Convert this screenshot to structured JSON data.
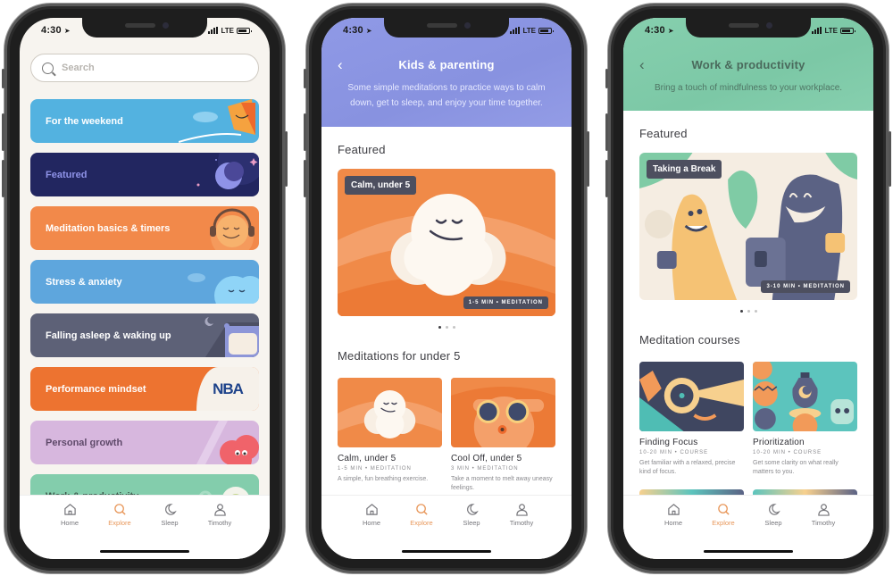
{
  "status_bar": {
    "time": "4:30",
    "network": "LTE"
  },
  "tabbar": {
    "items": [
      {
        "label": "Home",
        "icon": "home-icon"
      },
      {
        "label": "Explore",
        "icon": "search-icon",
        "active": true
      },
      {
        "label": "Sleep",
        "icon": "moon-icon"
      },
      {
        "label": "Timothy",
        "icon": "user-icon"
      }
    ],
    "active_color": "#e8975a"
  },
  "explore": {
    "search_placeholder": "Search",
    "categories": [
      {
        "label": "For the weekend",
        "color": "#53b2e0"
      },
      {
        "label": "Featured",
        "color": "#222660",
        "text_color": "#8f93e8"
      },
      {
        "label": "Meditation basics & timers",
        "color": "#f2894a"
      },
      {
        "label": "Stress & anxiety",
        "color": "#5ea6dd"
      },
      {
        "label": "Falling asleep & waking up",
        "color": "#5d6177"
      },
      {
        "label": "Performance mindset",
        "color": "#ed7330",
        "badge": "NBA"
      },
      {
        "label": "Personal growth",
        "color": "#d7b7de",
        "text_color": "#5f4a6a"
      },
      {
        "label": "Work & productivity",
        "color": "#83cdac",
        "text_color": "#3d5a4d"
      }
    ]
  },
  "kids": {
    "title": "Kids & parenting",
    "subtitle": "Some simple meditations to practice ways to calm down, get to sleep, and enjoy your time together.",
    "header_color": "#8d97e4",
    "featured_heading": "Featured",
    "featured": {
      "name": "Calm, under 5",
      "meta": "1-5 MIN • MEDITATION"
    },
    "carousel": {
      "count": 3,
      "active": 1
    },
    "list_heading": "Meditations for under 5",
    "items": [
      {
        "title": "Calm, under 5",
        "meta": "1-5 MIN • MEDITATION",
        "desc": "A simple, fun breathing exercise."
      },
      {
        "title": "Cool Off, under 5",
        "meta": "3 MIN • MEDITATION",
        "desc": "Take a moment to melt away uneasy feelings."
      }
    ]
  },
  "work": {
    "title": "Work & productivity",
    "subtitle": "Bring a touch of mindfulness to your workplace.",
    "header_color": "#83cdac",
    "featured_heading": "Featured",
    "featured": {
      "name": "Taking a Break",
      "meta": "3-10 MIN • MEDITATION"
    },
    "carousel": {
      "count": 3,
      "active": 1
    },
    "list_heading": "Meditation courses",
    "items": [
      {
        "title": "Finding Focus",
        "meta": "10-20 MIN • COURSE",
        "desc": "Get familiar with a relaxed, precise kind of focus."
      },
      {
        "title": "Prioritization",
        "meta": "10-20 MIN • COURSE",
        "desc": "Get some clarity on what really matters to you."
      }
    ]
  }
}
